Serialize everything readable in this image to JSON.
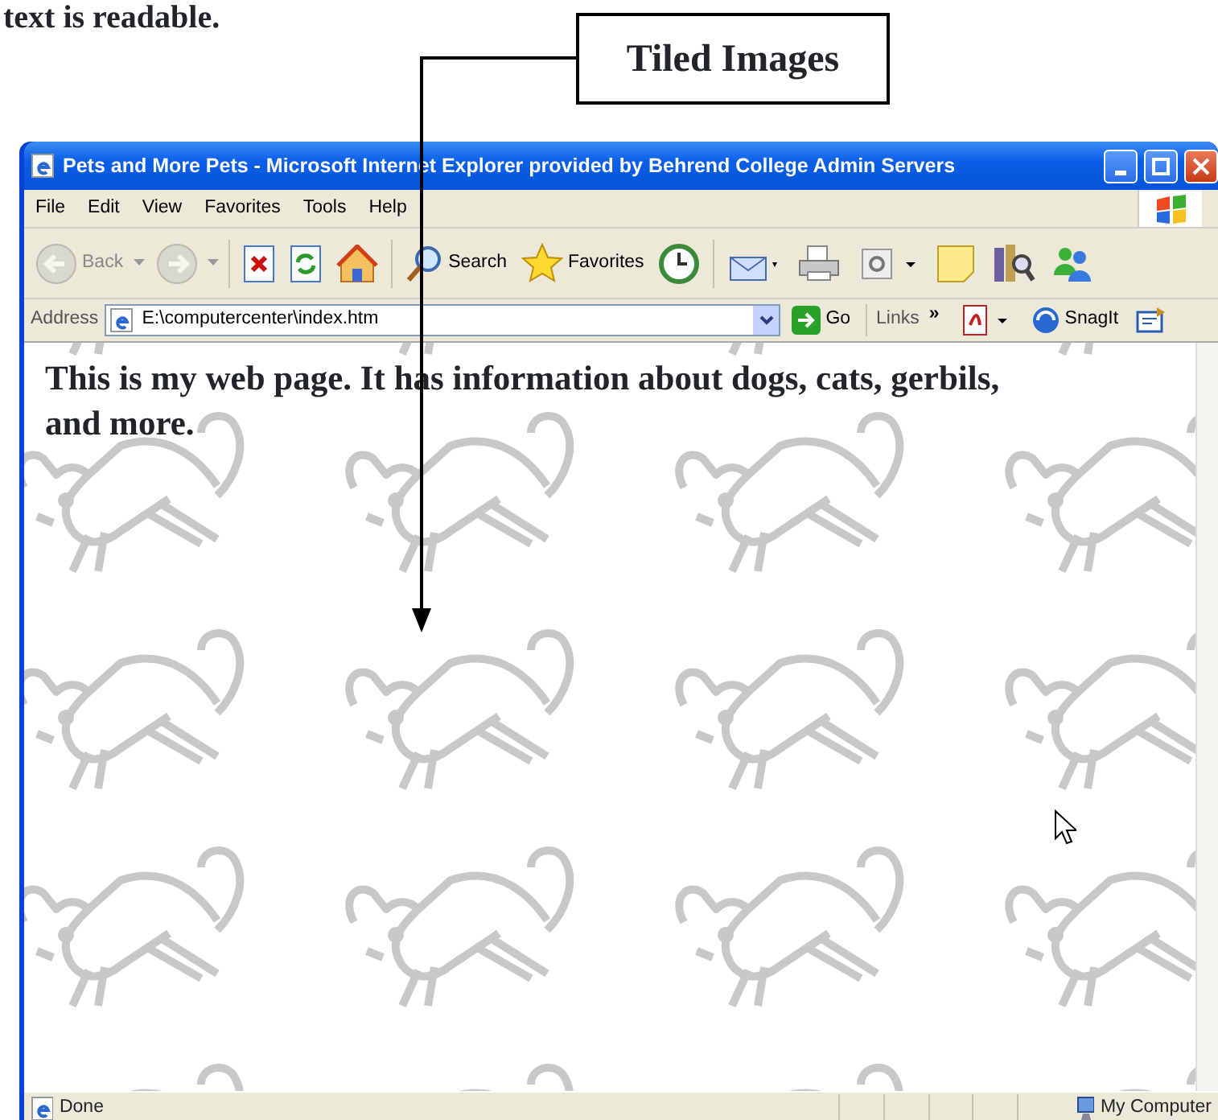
{
  "document_text": "text is readable.",
  "callout": {
    "label": "Tiled Images"
  },
  "window": {
    "title": "Pets and More Pets - Microsoft Internet Explorer provided by Behrend College Admin Servers"
  },
  "menu": [
    "File",
    "Edit",
    "View",
    "Favorites",
    "Tools",
    "Help"
  ],
  "toolbar": [
    {
      "kind": "back",
      "label": "Back",
      "disabled": true
    },
    {
      "kind": "forward",
      "disabled": true
    },
    {
      "kind": "stop",
      "disabled": false
    },
    {
      "kind": "refresh",
      "disabled": false
    },
    {
      "kind": "home",
      "disabled": false
    },
    {
      "kind": "search",
      "label": "Search",
      "disabled": false
    },
    {
      "kind": "favorites",
      "label": "Favorites",
      "disabled": false
    },
    {
      "kind": "history",
      "disabled": false
    },
    {
      "kind": "mail",
      "disabled": false
    },
    {
      "kind": "print",
      "disabled": false
    },
    {
      "kind": "edit",
      "disabled": false
    },
    {
      "kind": "note",
      "disabled": false
    },
    {
      "kind": "research",
      "disabled": false
    },
    {
      "kind": "messenger",
      "disabled": false
    }
  ],
  "address": {
    "label": "Address",
    "value": "E:\\computercenter\\index.htm",
    "go": "Go"
  },
  "links": {
    "label": "Links",
    "chevron": "»"
  },
  "extras": [
    {
      "kind": "pdf"
    },
    {
      "kind": "snagit",
      "label": "SnagIt"
    },
    {
      "kind": "capture"
    }
  ],
  "page": {
    "text": "This is my web page.  It has information about dogs, cats, gerbils, and more."
  },
  "status": {
    "text": "Done",
    "zone": "My Computer"
  }
}
